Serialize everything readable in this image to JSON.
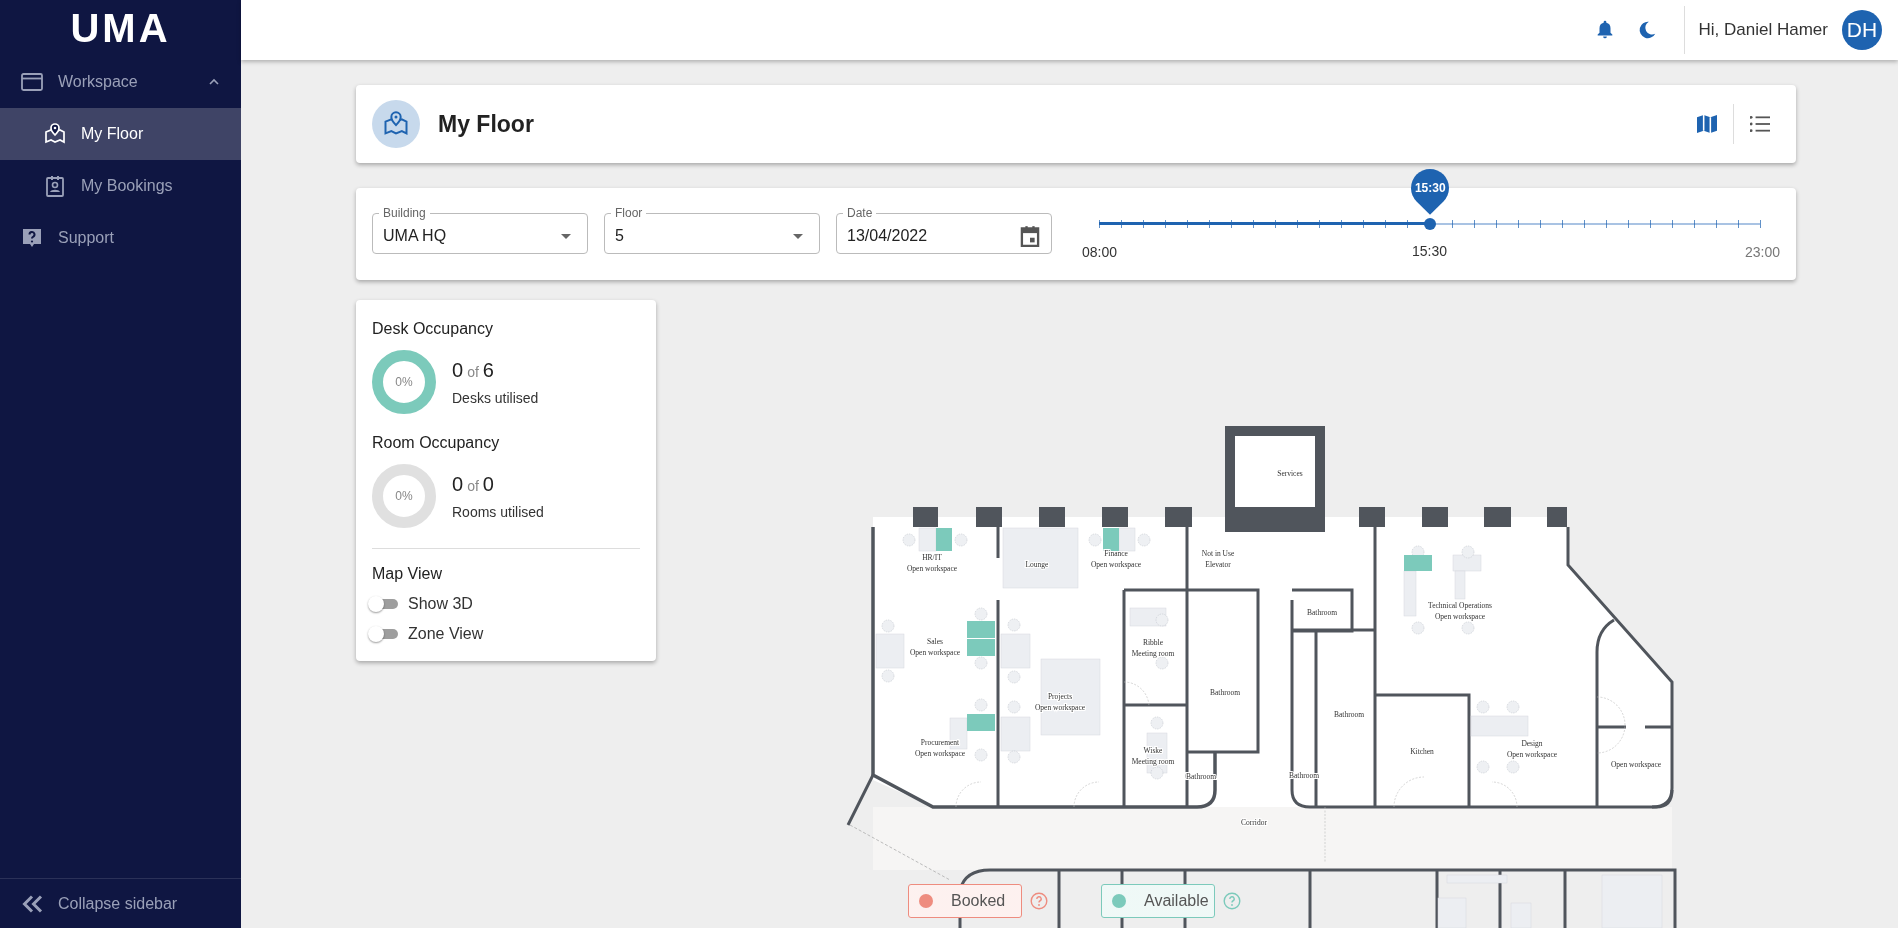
{
  "sidebar": {
    "logo": "UMA",
    "items": [
      {
        "label": "Workspace",
        "expanded": true,
        "selected": false,
        "children": [
          {
            "label": "My Floor",
            "selected": true
          },
          {
            "label": "My Bookings",
            "selected": false
          }
        ]
      },
      {
        "label": "Support",
        "selected": false
      }
    ],
    "collapse_label": "Collapse sidebar"
  },
  "header": {
    "greeting": "Hi, Daniel Hamer",
    "avatar_initials": "DH"
  },
  "page": {
    "title": "My Floor",
    "views": [
      {
        "kind": "map",
        "selected": true
      },
      {
        "kind": "list",
        "selected": false
      }
    ]
  },
  "filters": [
    {
      "label": "Building",
      "value": "UMA HQ",
      "kind": "select"
    },
    {
      "label": "Floor",
      "value": "5",
      "kind": "select"
    },
    {
      "label": "Date",
      "value": "13/04/2022",
      "kind": "date"
    }
  ],
  "time_slider": {
    "start": "08:00",
    "current": "15:30",
    "end": "23:00",
    "bubble": "15:30",
    "level": 0.5
  },
  "occupancy": [
    {
      "title": "Desk Occupancy",
      "percent": "0%",
      "count": "0",
      "of": "of",
      "total": "6",
      "caption": "Desks utilised",
      "color": "#7ccabb"
    },
    {
      "title": "Room Occupancy",
      "percent": "0%",
      "count": "0",
      "of": "of",
      "total": "0",
      "caption": "Rooms utilised",
      "color": "#e0e0e0"
    }
  ],
  "map_view": {
    "title": "Map View",
    "toggles": [
      {
        "label": "Show 3D",
        "on": false
      },
      {
        "label": "Zone View",
        "on": false
      }
    ]
  },
  "floor_plan": {
    "rooms": [
      {
        "name": "Services"
      },
      {
        "name": "HR/IT",
        "subtitle": "Open workspace"
      },
      {
        "name": "Lounge"
      },
      {
        "name": "Finance",
        "subtitle": "Open workspace"
      },
      {
        "name": "Not in Use",
        "subtitle": "Elevator"
      },
      {
        "name": "Sales",
        "subtitle": "Open workspace"
      },
      {
        "name": "Ribble",
        "subtitle": "Meeting room"
      },
      {
        "name": "Projects",
        "subtitle": "Open workspace"
      },
      {
        "name": "Bathroom"
      },
      {
        "name": "Procurement",
        "subtitle": "Open workspace"
      },
      {
        "name": "Wiske",
        "subtitle": "Meeting room"
      },
      {
        "name": "Bathroom"
      },
      {
        "name": "Corridor"
      },
      {
        "name": "Bathroom"
      },
      {
        "name": "Technical Operations",
        "subtitle": "Open workspace"
      },
      {
        "name": "Bathroom"
      },
      {
        "name": "Bathroom"
      },
      {
        "name": "Kitchen"
      },
      {
        "name": "Design",
        "subtitle": "Open workspace"
      },
      {
        "name": "Open workspace"
      }
    ],
    "desks": [
      {
        "booked": false
      },
      {
        "booked": false
      },
      {
        "booked": false
      },
      {
        "booked": false
      },
      {
        "booked": false
      },
      {
        "booked": false
      }
    ]
  },
  "legend": [
    {
      "kind": "booked",
      "label": "Booked",
      "color": "#ee8c7f"
    },
    {
      "kind": "available",
      "label": "Available",
      "color": "#7ccabb"
    }
  ]
}
